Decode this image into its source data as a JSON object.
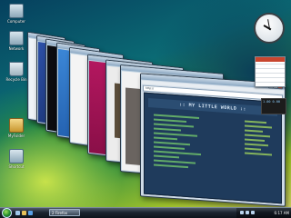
{
  "desktop": {
    "icons": [
      {
        "label": "Computer",
        "kind": "computer"
      },
      {
        "label": "Network",
        "kind": "network"
      },
      {
        "label": "Recycle Bin",
        "kind": "recycle-bin"
      },
      {
        "label": "MyFolder",
        "kind": "folder"
      },
      {
        "label": "Shortcut",
        "kind": "file"
      }
    ]
  },
  "front_window": {
    "address": "http://",
    "banner_text": ":: MY LITTLE WORLD ::"
  },
  "gadgets": {
    "stock_text": "1.00 0.00"
  },
  "taskbar": {
    "task_label": "2 Firefox",
    "clock": "6:17 AM"
  }
}
